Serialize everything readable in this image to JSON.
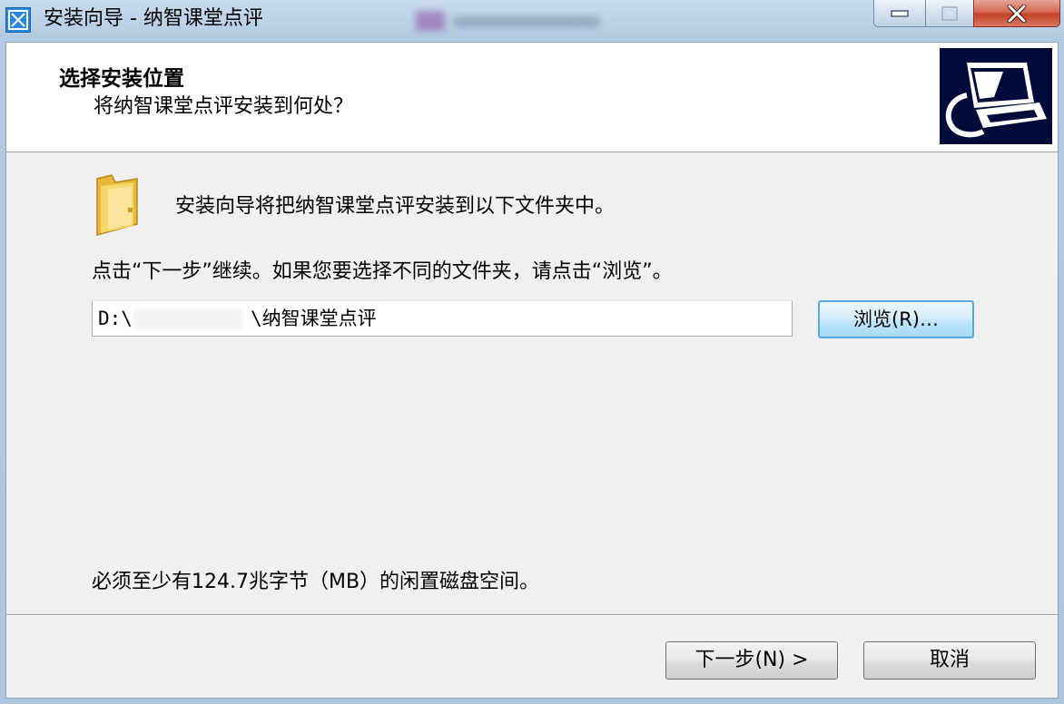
{
  "window": {
    "title": "安装向导 - 纳智课堂点评"
  },
  "header": {
    "title": "选择安装位置",
    "subtitle": "将纳智课堂点评安装到何处？"
  },
  "body": {
    "intro": "安装向导将把纳智课堂点评安装到以下文件夹中。",
    "instruction": "点击“下一步”继续。如果您要选择不同的文件夹，请点击“浏览”。",
    "path_prefix": "D:\\",
    "path_suffix": "\\纳智课堂点评",
    "browse_label": "浏览(R)…",
    "space_required": "必须至少有124.7兆字节（MB）的闲置磁盘空间。"
  },
  "footer": {
    "next_label": "下一步(N) >",
    "cancel_label": "取消"
  },
  "icons": {
    "app": "installer-app-icon",
    "folder": "folder-icon",
    "header_image": "computer-install-icon"
  }
}
